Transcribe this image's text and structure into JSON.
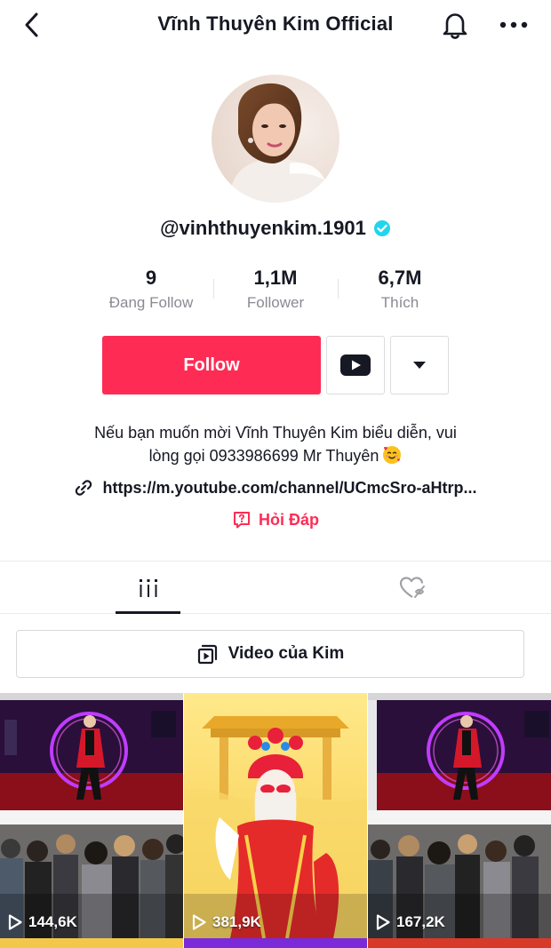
{
  "header": {
    "title": "Vĩnh Thuyên Kim Official",
    "back_icon": "chevron-left-icon",
    "bell_icon": "bell-icon",
    "more_icon": "more-horizontal-icon"
  },
  "profile": {
    "handle": "@vinhthuyenkim.1901",
    "verified": true,
    "avatar_icon": "avatar"
  },
  "stats": [
    {
      "value": "9",
      "label": "Đang Follow"
    },
    {
      "value": "1,1M",
      "label": "Follower"
    },
    {
      "value": "6,7M",
      "label": "Thích"
    }
  ],
  "actions": {
    "follow_label": "Follow",
    "youtube_icon": "youtube-icon",
    "dropdown_icon": "caret-down-icon"
  },
  "bio": {
    "line1": "Nếu bạn muốn mời Vĩnh Thuyên Kim biểu diễn, vui",
    "line2": "lòng gọi 0933986699 Mr Thuyên",
    "emoji": "smiling-face-with-hearts-emoji"
  },
  "link": {
    "icon": "link-icon",
    "text": "https://m.youtube.com/channel/UCmcSro-aHtrp..."
  },
  "qa": {
    "icon": "question-box-icon",
    "text": "Hỏi Đáp"
  },
  "tabs": [
    {
      "icon": "videos-grid-icon",
      "active": true
    },
    {
      "icon": "liked-hidden-heart-icon",
      "active": false
    }
  ],
  "playlist": {
    "icon": "playlist-icon",
    "label": "Video của Kim"
  },
  "videos": [
    {
      "views": "144,6K"
    },
    {
      "views": "381,9K"
    },
    {
      "views": "167,2K"
    }
  ],
  "colors": {
    "accent": "#fe2c55",
    "verified": "#20d5ec",
    "text": "#161823",
    "muted": "#8a8b91"
  }
}
